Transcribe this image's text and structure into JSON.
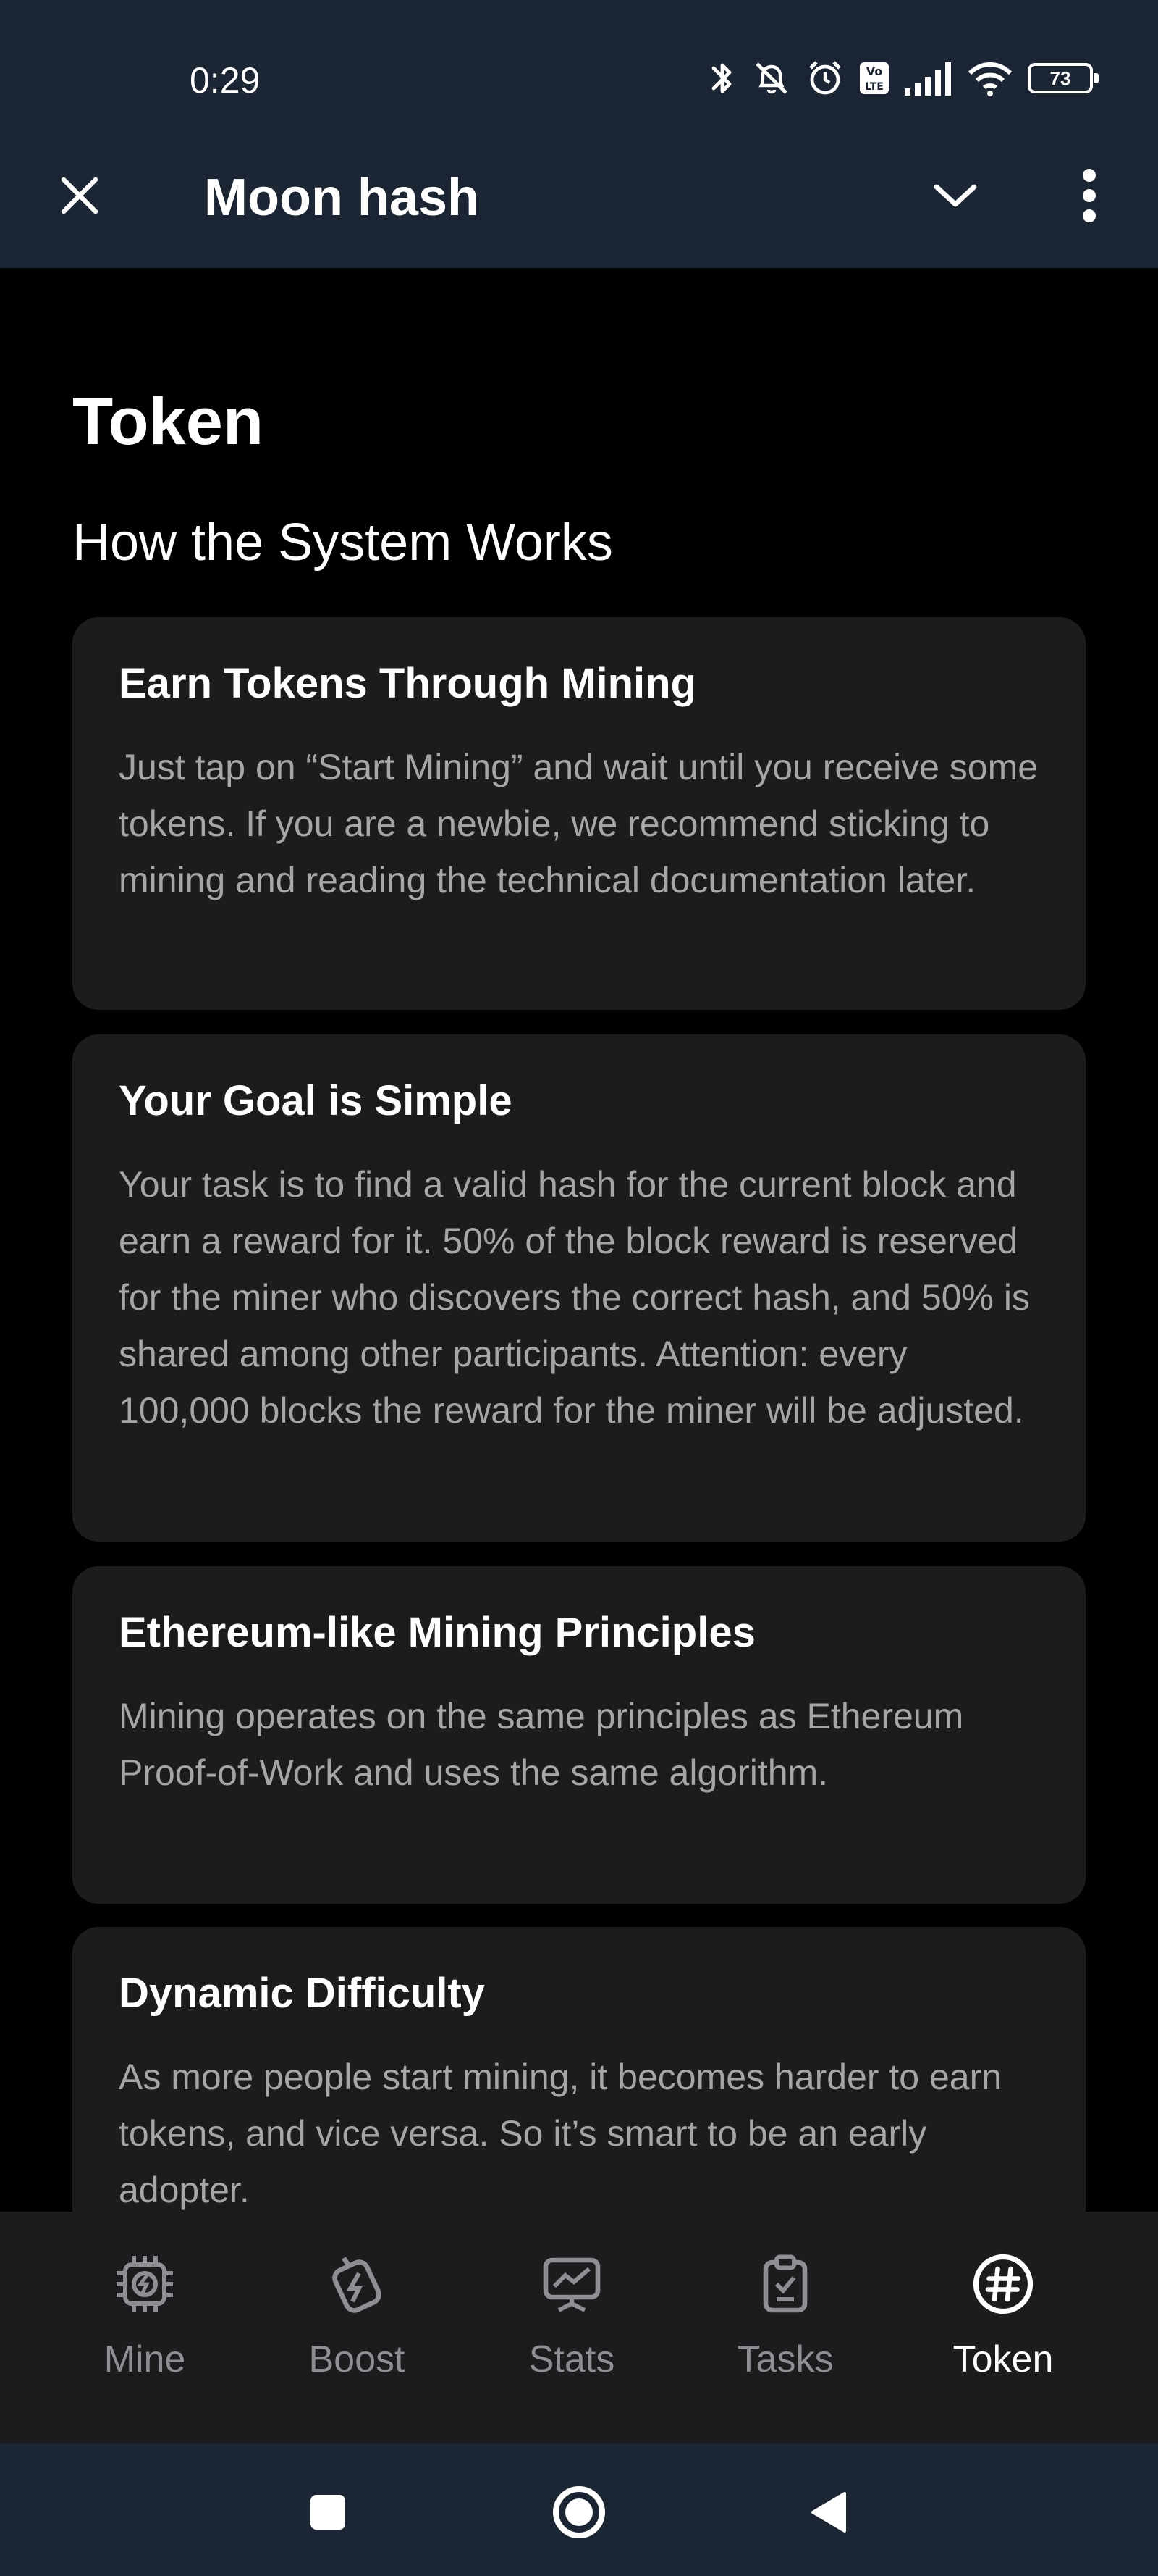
{
  "status_bar": {
    "time": "0:29",
    "battery": "73",
    "icons": [
      "bluetooth-icon",
      "bell-off-icon",
      "alarm-icon",
      "volte-icon",
      "signal-icon",
      "wifi-icon",
      "battery-icon"
    ]
  },
  "header": {
    "title": "Moon hash",
    "icons": [
      "close-icon",
      "chevron-down-icon",
      "more-vertical-icon"
    ]
  },
  "page": {
    "title": "Token",
    "section_title": "How the System Works",
    "cards": [
      {
        "title": "Earn Tokens Through Mining",
        "body": "Just tap on “Start Mining” and wait until you receive some tokens. If you are a newbie, we recommend sticking to mining and reading the technical documentation later."
      },
      {
        "title": "Your Goal is Simple",
        "body": "Your task is to find a valid hash for the current block and earn a reward for it. 50% of the block reward is reserved for the miner who discovers the correct hash, and 50% is shared among other participants. Attention: every 100,000 blocks the reward for the miner will be adjusted."
      },
      {
        "title": "Ethereum-like Mining Principles",
        "body": "Mining operates on the same principles as Ethereum Proof-of-Work and uses the same algorithm."
      },
      {
        "title": "Dynamic Difficulty",
        "body": "As more people start mining, it becomes harder to earn tokens, and vice versa. So it’s smart to be an early adopter."
      }
    ]
  },
  "bottom_nav": {
    "active": "Token",
    "items": [
      {
        "label": "Mine",
        "icon": "chip-icon"
      },
      {
        "label": "Boost",
        "icon": "boost-icon"
      },
      {
        "label": "Stats",
        "icon": "stats-icon"
      },
      {
        "label": "Tasks",
        "icon": "tasks-icon"
      },
      {
        "label": "Token",
        "icon": "hash-icon"
      }
    ]
  },
  "system_nav": {
    "icons": [
      "recents-icon",
      "home-icon",
      "back-icon"
    ]
  },
  "colors": {
    "header_bg": "#1c2533",
    "page_bg": "#000000",
    "card_bg": "#1c1c1e",
    "body_text": "#a6a6a8",
    "inactive_nav": "#8e8e93"
  }
}
